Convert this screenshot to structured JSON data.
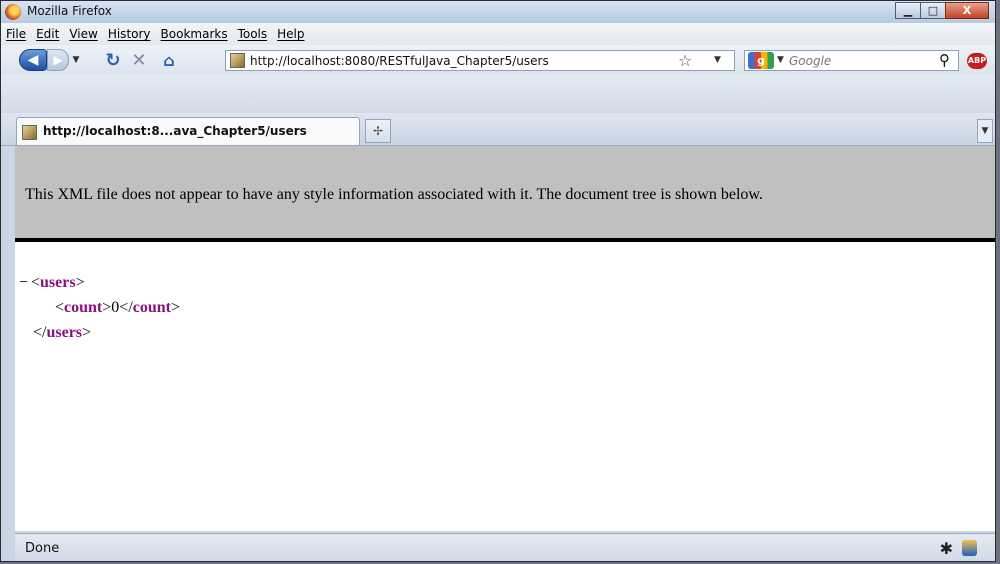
{
  "window": {
    "title": "Mozilla Firefox",
    "minimize": "▁",
    "maximize": "□",
    "close": "X"
  },
  "menubar": {
    "items": [
      "File",
      "Edit",
      "View",
      "History",
      "Bookmarks",
      "Tools",
      "Help"
    ]
  },
  "nav": {
    "back": "◀",
    "forward": "▶",
    "url": "http://localhost:8080/RESTfulJava_Chapter5/users",
    "search_engine": "g",
    "search_placeholder": "Google",
    "addon_badge": "ABP"
  },
  "tabs": [
    {
      "label": "http://localhost:8...ava_Chapter5/users",
      "active": true
    }
  ],
  "content": {
    "xml_notice": "This XML file does not appear to have any style information associated with it. The document tree is shown below.",
    "tree": {
      "root_tag": "users",
      "child_tag": "count",
      "child_value": "0",
      "collapse_marker": "−"
    }
  },
  "status": {
    "text": "Done"
  },
  "colors": {
    "tag_color": "#881280",
    "notice_bg": "#c0c0c0",
    "chrome_bg": "#c9d6e6"
  },
  "icons": [
    "firefox-logo-icon",
    "back-arrow-icon",
    "forward-arrow-icon",
    "reload-icon",
    "stop-icon",
    "home-icon",
    "page-favicon-icon",
    "bookmark-star-icon",
    "google-icon",
    "search-magnifier-icon",
    "adblock-plus-icon",
    "new-tab-icon",
    "firebug-icon",
    "security-shield-icon"
  ]
}
